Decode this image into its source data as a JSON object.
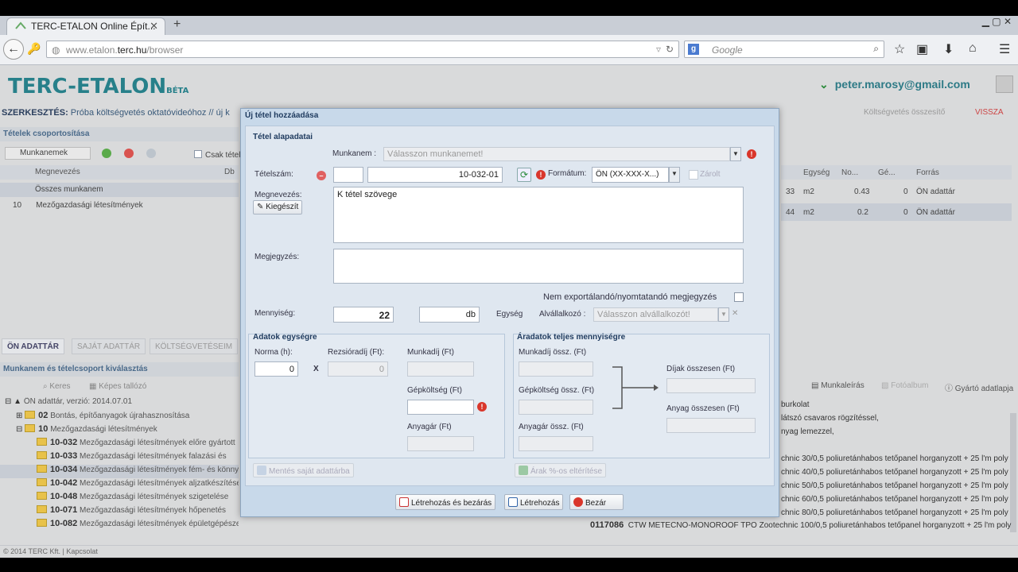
{
  "browser": {
    "tab_title": "TERC-ETALON Online Épít...",
    "url_prefix": "www.etalon.",
    "url_domain": "terc.hu",
    "url_path": "/browser",
    "search_placeholder": "Google"
  },
  "header": {
    "logo": "TERC-ETALON",
    "logo_beta": "BÉTA",
    "user_email": "peter.marosy@gmail.com"
  },
  "editbar": {
    "label": "SZERKESZTÉS:",
    "project": "Próba költségvetés oktatóvideóhoz // új k",
    "right_hint": "Költségvetés összesítő",
    "back": "VISSZA"
  },
  "left_panel": {
    "section_title": "Tételek csoportosítása",
    "group_select": "Munkanemek",
    "only_items": "Csak tétel",
    "columns": [
      "Megnevezés",
      "Db"
    ],
    "rows": [
      {
        "num": "",
        "name": "Összes munkanem"
      },
      {
        "num": "10",
        "name": "Mezőgazdasági létesítmények"
      }
    ],
    "tabs": [
      "ÖN ADATTÁR",
      "SAJÁT ADATTÁR",
      "KÖLTSÉGVETÉSEIM"
    ],
    "tree_title": "Munkanem és tételcsoport kiválasztás",
    "tree_tools": [
      "Keres",
      "Képes tallózó"
    ],
    "tree": [
      {
        "code": "",
        "text": "ÖN adattár, verzió: 2014.07.01",
        "level": 0
      },
      {
        "code": "02",
        "text": "Bontás, építőanyagok újrahasznosítása",
        "level": 1
      },
      {
        "code": "10",
        "text": "Mezőgazdasági létesítmények",
        "level": 1
      },
      {
        "code": "10-032",
        "text": "Mezőgazdasági létesítmények előre gyártott",
        "level": 2
      },
      {
        "code": "10-033",
        "text": "Mezőgazdasági létesítmények falazási és",
        "level": 2
      },
      {
        "code": "10-034",
        "text": "Mezőgazdasági létesítmények fém- és könnyű",
        "level": 2,
        "selected": true
      },
      {
        "code": "10-042",
        "text": "Mezőgazdasági létesítmények aljzatkészítése",
        "level": 2
      },
      {
        "code": "10-048",
        "text": "Mezőgazdasági létesítmények szigetelése",
        "level": 2
      },
      {
        "code": "10-071",
        "text": "Mezőgazdasági létesítmények hőpenetés",
        "level": 2
      },
      {
        "code": "10-082",
        "text": "Mezőgazdasági létesítmények épületgépészeti szerelvények és berendezések szerelése",
        "level": 2
      }
    ],
    "status": "© 2014 TERC Kft. | Kapcsolat"
  },
  "right_panel": {
    "columns": [
      "Egység",
      "No...",
      "Gé...",
      "Forrás"
    ],
    "rows": [
      {
        "n": "33",
        "unit": "m2",
        "no": "0.43",
        "ge": "0",
        "src": "ÖN adattár"
      },
      {
        "n": "44",
        "unit": "m2",
        "no": "0.2",
        "ge": "0",
        "src": "ÖN adattár"
      }
    ],
    "tools": [
      "Munkaleírás",
      "Fotóalbum",
      "Gyártó adatlapja"
    ],
    "lines": [
      "burkolat",
      "látszó csavaros rögzítéssel,",
      "nyag lemezzel,",
      "chnic 30/0,5 poliuretánhabos tetőpanel horganyzott + 25 l'm poly",
      "chnic 40/0,5 poliuretánhabos tetőpanel horganyzott + 25 l'm poly",
      "chnic 50/0,5 poliuretánhabos tetőpanel horganyzott + 25 l'm poly",
      "chnic 60/0,5 poliuretánhabos tetőpanel horganyzott + 25 l'm poly",
      "chnic 80/0,5 poliuretánhabos tetőpanel horganyzott + 25 l'm poly"
    ],
    "bottom_code": "0117086",
    "bottom_text": "CTW METECNO-MONOROOF TPO Zootechnic 100/0,5 poliuretánhabos tetőpanel horganyzott + 25 l'm poly"
  },
  "modal": {
    "title": "Új tétel hozzáadása",
    "basic_section": "Tétel alapadatai",
    "munkanem_label": "Munkanem :",
    "munkanem_placeholder": "Válasszon munkanemet!",
    "tetelszam_label": "Tételszám:",
    "tetelszam_prefix": "",
    "tetelszam_value": "10-032-01",
    "format_label": "Formátum:",
    "format_value": "ÖN (XX-XXX-X...)",
    "zarolt_label": "Zárolt",
    "megnevezes_label": "Megnevezés:",
    "kiegeszit_button": "Kiegészít",
    "megnevezes_value": "K tétel szövege",
    "megjegyzes_label": "Megjegyzés:",
    "megjegyzes_value": "",
    "nem_export_label": "Nem exportálandó/nyomtatandó megjegyzés",
    "mennyiseg_label": "Mennyiség:",
    "mennyiseg_value": "22",
    "unit_value": "db",
    "egyseg_label": "Egység",
    "alvallalkozo_label": "Alvállalkozó :",
    "alvallalkozo_placeholder": "Válasszon alvállalkozót!",
    "unit_section": "Adatok egységre",
    "norma_label": "Norma (h):",
    "norma_value": "0",
    "x_sign": "X",
    "rezsioradij_label": "Rezsióradíj (Ft):",
    "rezsioradij_value": "0",
    "munkadij_label": "Munkadíj (Ft)",
    "gepkoltseg_label": "Gépköltség (Ft)",
    "anyagar_label": "Anyagár (Ft)",
    "mentes_button": "Mentés saját adattárba",
    "total_section": "Áradatok teljes mennyiségre",
    "munkadij_ossz_label": "Munkadíj össz. (Ft)",
    "gepkoltseg_ossz_label": "Gépköltség össz. (Ft)",
    "anyagar_ossz_label": "Anyagár össz. (Ft)",
    "dijak_label": "Díjak összesen (Ft)",
    "anyag_label": "Anyag összesen (Ft)",
    "arak_button": "Árak %-os eltérítése",
    "btn_create_close": "Létrehozás és bezárás",
    "btn_create": "Létrehozás",
    "btn_close": "Bezár"
  }
}
